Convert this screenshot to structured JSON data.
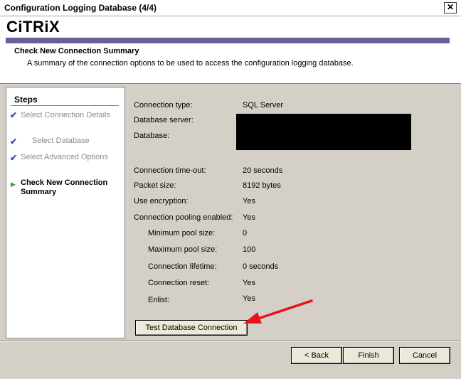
{
  "window": {
    "title": "Configuration Logging Database (4/4)",
    "close_glyph": "✕"
  },
  "header": {
    "logo": "CiTRiX",
    "title": "Check New Connection Summary",
    "subtitle": "A summary of the connection options to be used to access the configuration logging database."
  },
  "steps": {
    "title": "Steps",
    "items": [
      {
        "label": "Select Connection Details",
        "status": "done"
      },
      {
        "label": "Select Database",
        "status": "done"
      },
      {
        "label": "Select Advanced Options",
        "status": "done"
      },
      {
        "label": "Check New Connection Summary",
        "status": "current"
      }
    ]
  },
  "summary": {
    "connection_type": {
      "label": "Connection type:",
      "value": "SQL Server"
    },
    "database_server": {
      "label": "Database server:"
    },
    "database": {
      "label": "Database:"
    },
    "timeout": {
      "label": "Connection time-out:",
      "value": "20 seconds"
    },
    "packet_size": {
      "label": "Packet size:",
      "value": "8192 bytes"
    },
    "encryption": {
      "label": "Use encryption:",
      "value": "Yes"
    },
    "pooling": {
      "label": "Connection pooling enabled:",
      "value": "Yes"
    },
    "min_pool": {
      "label": "Minimum pool size:",
      "value": "0"
    },
    "max_pool": {
      "label": "Maximum pool size:",
      "value": "100"
    },
    "lifetime": {
      "label": "Connection lifetime:",
      "value": "0 seconds"
    },
    "reset": {
      "label": "Connection reset:",
      "value": "Yes"
    },
    "enlist": {
      "label": "Enlist:",
      "value": "Yes"
    }
  },
  "buttons": {
    "test": "Test Database Connection",
    "back": "< Back",
    "finish": "Finish",
    "cancel": "Cancel"
  },
  "colors": {
    "accent_bar": "#65619a",
    "check": "#3a46a8",
    "current_arrow": "#3c9a3c",
    "annotation_arrow": "#e8141c"
  }
}
